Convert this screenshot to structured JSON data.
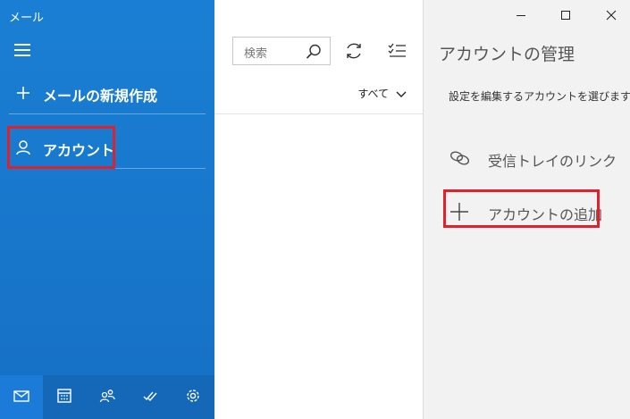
{
  "app": {
    "title": "メール"
  },
  "sidebar": {
    "new_mail_label": "メールの新規作成",
    "account_label": "アカウント",
    "bottom_icons": [
      "mail-icon",
      "calendar-icon",
      "people-icon",
      "todo-icon",
      "settings-icon"
    ]
  },
  "middle": {
    "search_placeholder": "検索",
    "filter_label": "すべて"
  },
  "panel": {
    "title": "アカウントの管理",
    "description": "設定を編集するアカウントを選びます。",
    "link_inbox_label": "受信トレイのリンク",
    "add_account_label": "アカウントの追加"
  },
  "colors": {
    "sidebar_bg": "#1670c4",
    "highlight_red": "#e0202a",
    "panel_bg": "#f2f2f2"
  }
}
